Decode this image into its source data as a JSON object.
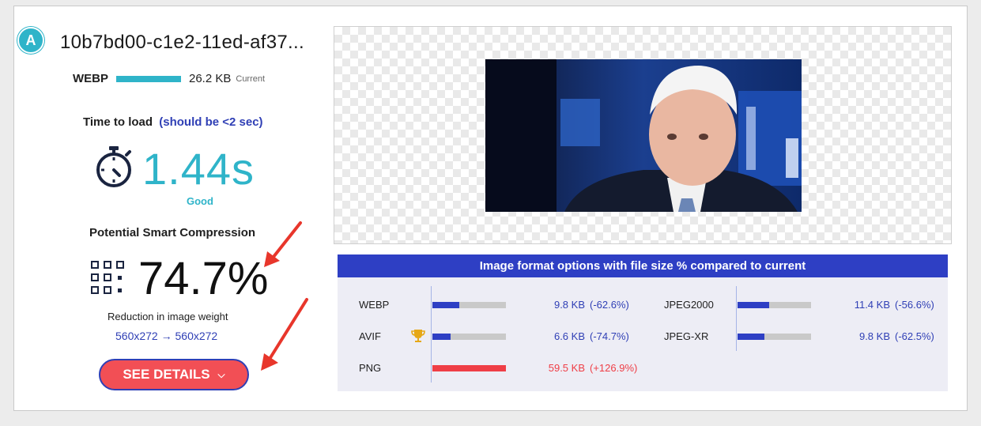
{
  "badge": "A",
  "filename": "10b7bd00-c1e2-11ed-af37...",
  "current": {
    "format": "WEBP",
    "size": "26.2 KB",
    "tag": "Current"
  },
  "load": {
    "label": "Time to load",
    "hint": "(should be <2 sec)",
    "value": "1.44s",
    "rating": "Good"
  },
  "compression": {
    "label": "Potential Smart Compression",
    "value": "74.7%",
    "reduction_label": "Reduction in image weight",
    "dims": "560x272 → 560x272",
    "button": "SEE DETAILS"
  },
  "panel": {
    "title": "Image format options with file size % compared to current",
    "options_left": [
      {
        "name": "WEBP",
        "size": "9.8 KB",
        "delta": "(-62.6%)",
        "fill": 0.37,
        "color": "#2e3fc4",
        "winner": false
      },
      {
        "name": "AVIF",
        "size": "6.6 KB",
        "delta": "(-74.7%)",
        "fill": 0.25,
        "color": "#2e3fc4",
        "winner": true
      },
      {
        "name": "PNG",
        "size": "59.5 KB",
        "delta": "(+126.9%)",
        "fill": 1.0,
        "color": "#ef3e46",
        "winner": false
      }
    ],
    "options_right": [
      {
        "name": "JPEG2000",
        "size": "11.4 KB",
        "delta": "(-56.6%)",
        "fill": 0.43,
        "color": "#2e3fc4"
      },
      {
        "name": "JPEG-XR",
        "size": "9.8 KB",
        "delta": "(-62.5%)",
        "fill": 0.37,
        "color": "#2e3fc4"
      }
    ]
  },
  "colors": {
    "accent": "#2fb4c9",
    "brand_blue": "#2e3fc4",
    "danger": "#f24f55",
    "arrow": "#e8362b"
  }
}
